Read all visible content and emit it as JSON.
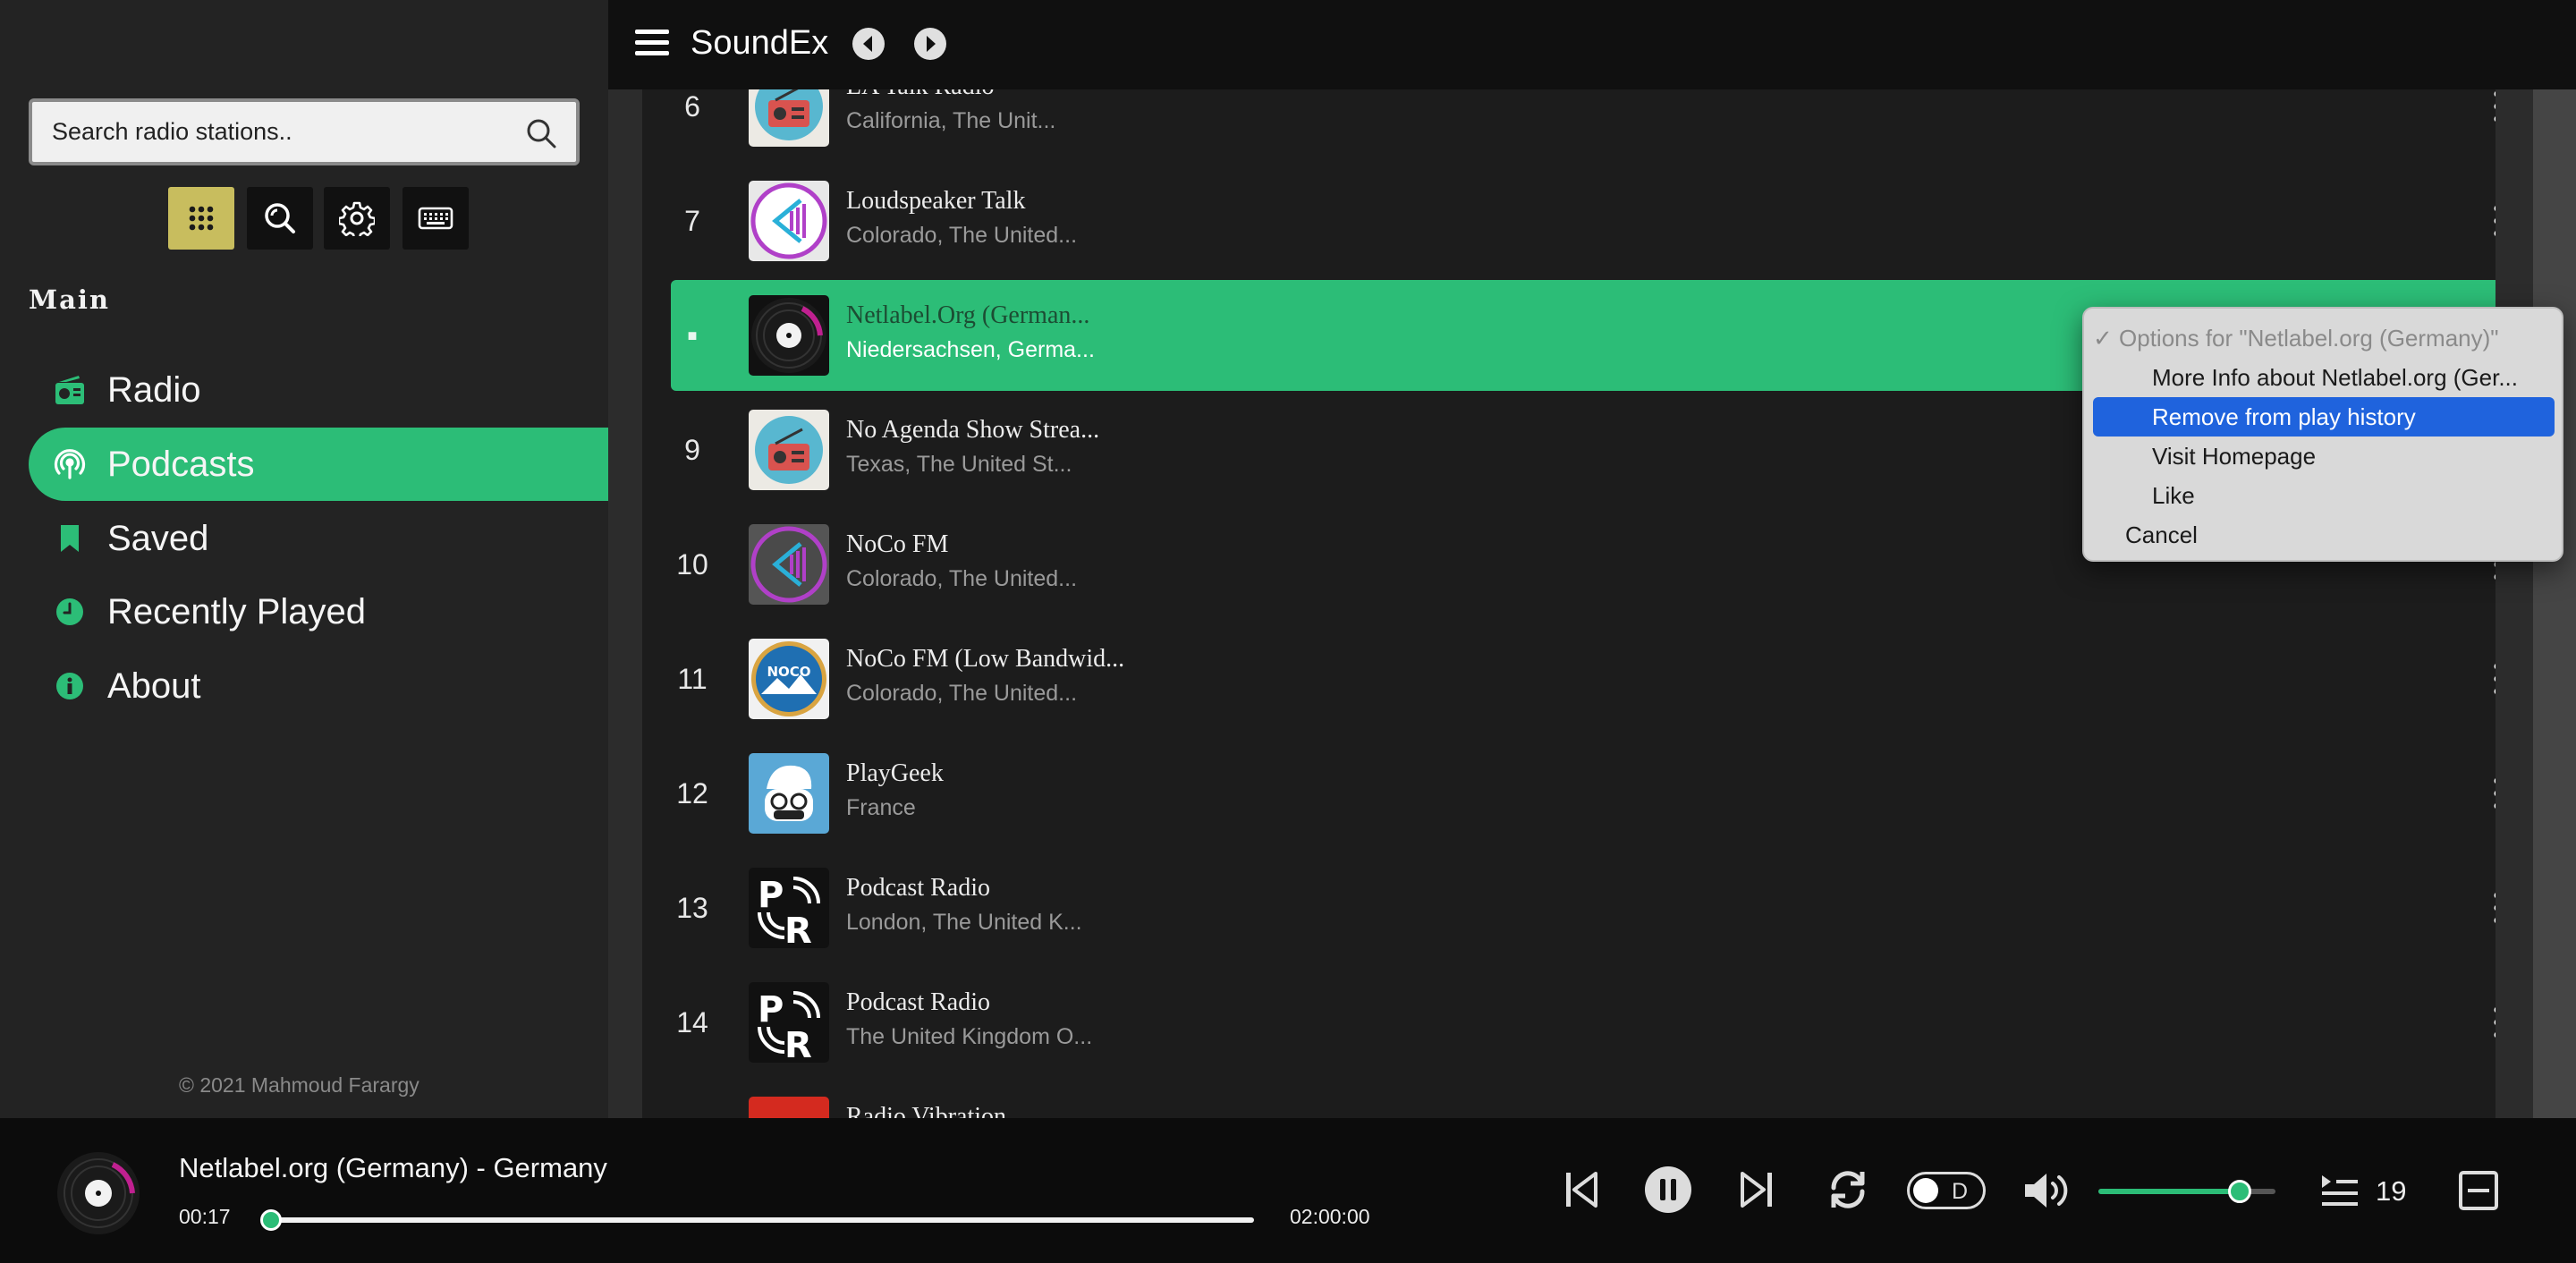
{
  "app": {
    "title": "SoundEx"
  },
  "search": {
    "placeholder": "Search radio stations.."
  },
  "toolbar": [
    "grid-icon",
    "zoom-search-icon",
    "gear-icon",
    "keyboard-icon"
  ],
  "sidebar": {
    "section": "Main",
    "items": [
      {
        "label": "Radio",
        "icon": "radio-icon"
      },
      {
        "label": "Podcasts",
        "icon": "podcast-icon",
        "active": true
      },
      {
        "label": "Saved",
        "icon": "bookmark-icon"
      },
      {
        "label": "Recently Played",
        "icon": "clock-icon"
      },
      {
        "label": "About",
        "icon": "info-icon"
      }
    ],
    "copyright": "© 2021 Mahmoud Fararg​y"
  },
  "stations": [
    {
      "num": "6",
      "title": "LA Talk Radio",
      "subtitle": "California, The Unit..."
    },
    {
      "num": "7",
      "title": "Loudspeaker Talk",
      "subtitle": "Colorado, The United..."
    },
    {
      "num": "■",
      "title": "Netlabel.Org (German...",
      "subtitle": "Niedersachsen, Germa...",
      "playing": true
    },
    {
      "num": "9",
      "title": "No Agenda Show Strea...",
      "subtitle": "Texas, The United St..."
    },
    {
      "num": "10",
      "title": "NoCo FM",
      "subtitle": "Colorado, The United..."
    },
    {
      "num": "11",
      "title": "NoCo FM (Low Bandwid...",
      "subtitle": "Colorado, The United..."
    },
    {
      "num": "12",
      "title": "PlayGeek",
      "subtitle": "France"
    },
    {
      "num": "13",
      "title": "Podcast Radio",
      "subtitle": "London, The United K..."
    },
    {
      "num": "14",
      "title": "Podcast Radio",
      "subtitle": "The United Kingdom O..."
    },
    {
      "num": "",
      "title": "Radio Vibration",
      "subtitle": ""
    }
  ],
  "context_menu": {
    "header": "✓ Options for \"Netlabel.org (Germany)\"",
    "items": [
      {
        "label": "More Info about Netlabel.org (Ger..."
      },
      {
        "label": "Remove from play history",
        "highlighted": true
      },
      {
        "label": "Visit Homepage"
      },
      {
        "label": "Like"
      }
    ],
    "cancel": "Cancel"
  },
  "player": {
    "title": "Netlabel.org (Germany) - Germany",
    "elapsed": "00:17",
    "duration": "02:00:00",
    "progress": 0.0024,
    "volume": 0.8,
    "dark_mode_toggle": "D",
    "queue_count": "19"
  },
  "colors": {
    "accent": "#2cbd77",
    "highlight": "#1f63dd",
    "toolbar_active": "#c8bd5e"
  }
}
